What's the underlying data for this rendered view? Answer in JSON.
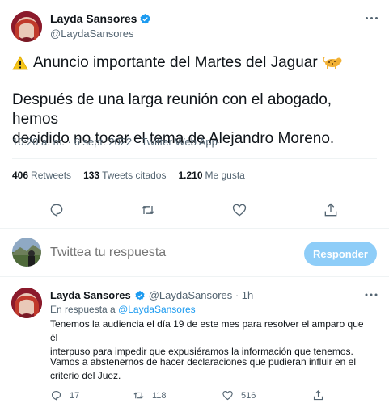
{
  "tweet": {
    "author_name": "Layda Sansores",
    "author_handle": "@LaydaSansores",
    "headline": "Anuncio importante del Martes del Jaguar",
    "body_line1": "Después de una larga reunión con el abogado, hemos",
    "body_line2": "decidido no tocar el tema de Alejandro Moreno.",
    "timestamp": "10:20 a. m. · 6 sept. 2022 · Twitter Web App",
    "stats": {
      "retweets_count": "406",
      "retweets_label": "Retweets",
      "quotes_count": "133",
      "quotes_label": "Tweets citados",
      "likes_count": "1.210",
      "likes_label": "Me gusta"
    },
    "icons": [
      "warning-icon",
      "leopard-icon",
      "verified-icon",
      "more-icon",
      "reply-icon",
      "retweet-icon",
      "like-icon",
      "share-icon"
    ]
  },
  "composer": {
    "placeholder": "Twittea tu respuesta",
    "reply_button": "Responder"
  },
  "reply_tweet": {
    "author_name": "Layda Sansores",
    "author_handle": "@LaydaSansores · 1h",
    "in_reply_prefix": "En respuesta a",
    "in_reply_handle": "@LaydaSansores",
    "body_p1_line1": "Tenemos la audiencia el día 19 de este mes para resolver el amparo que él",
    "body_p1_line2": "interpuso para impedir que expusiéramos la información que tenemos.",
    "body_p2_line1": "Vamos a abstenernos de hacer declaraciones que pudieran influir en el",
    "body_p2_line2": "criterio del Juez.",
    "replies": "17",
    "retweets": "118",
    "likes": "516"
  },
  "colors": {
    "accent": "#1d9bf0",
    "button_disabled": "#8ecdf8",
    "secondary_text": "#536471",
    "divider": "#eff3f4"
  }
}
